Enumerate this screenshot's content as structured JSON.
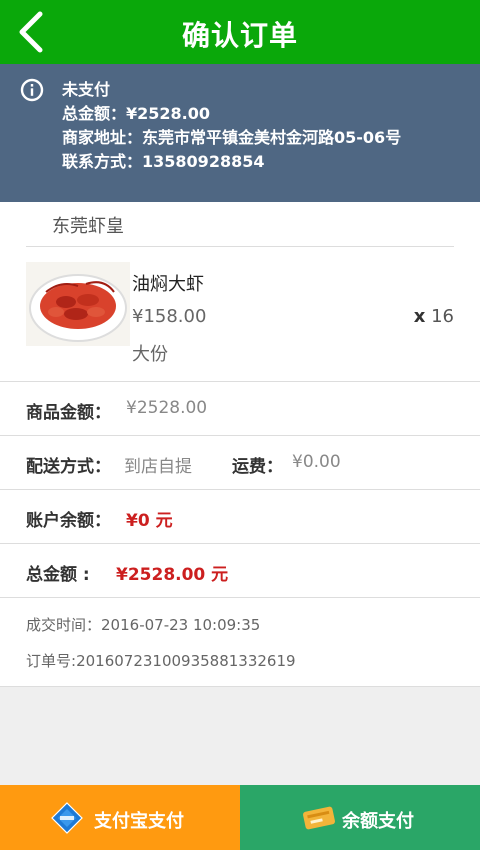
{
  "header": {
    "title": "确认订单"
  },
  "notice": {
    "status": "未支付",
    "total_label": "总金额：",
    "total_value": "¥2528.00",
    "address_label": "商家地址：",
    "address_value": "东莞市常平镇金美村金河路05-06号",
    "contact_label": "联系方式：",
    "contact_value": "13580928854"
  },
  "shop": {
    "name": "东莞虾皇"
  },
  "product": {
    "name": "油焖大虾",
    "price": "¥158.00",
    "size": "大份",
    "qty_prefix": "x",
    "qty": "16"
  },
  "summary": {
    "goods_label": "商品金额：",
    "goods_value": "¥2528.00",
    "delivery_label": "配送方式：",
    "delivery_value": "到店自提",
    "freight_label": "运费：",
    "freight_value": "¥0.00",
    "balance_label": "账户余额：",
    "balance_value": "¥0 元",
    "total_label": "总金额 :",
    "total_value": "¥2528.00 元"
  },
  "order": {
    "time_label": "成交时间：",
    "time_value": "2016-07-23 10:09:35",
    "number_label": "订单号:",
    "number_value": "20160723100935881332619"
  },
  "payment": {
    "alipay_label": "支付宝支付",
    "balance_label": "余额支付"
  },
  "colors": {
    "header_bg": "#0aa80a",
    "notice_bg": "#4f6783",
    "alipay_bg": "#ff9a10",
    "balance_bg": "#2aa667",
    "accent_red": "#cc1f1f"
  },
  "icons": {
    "back": "chevron-left-icon",
    "info": "info-circle-icon",
    "alipay": "alipay-icon",
    "wallet": "wallet-icon"
  }
}
